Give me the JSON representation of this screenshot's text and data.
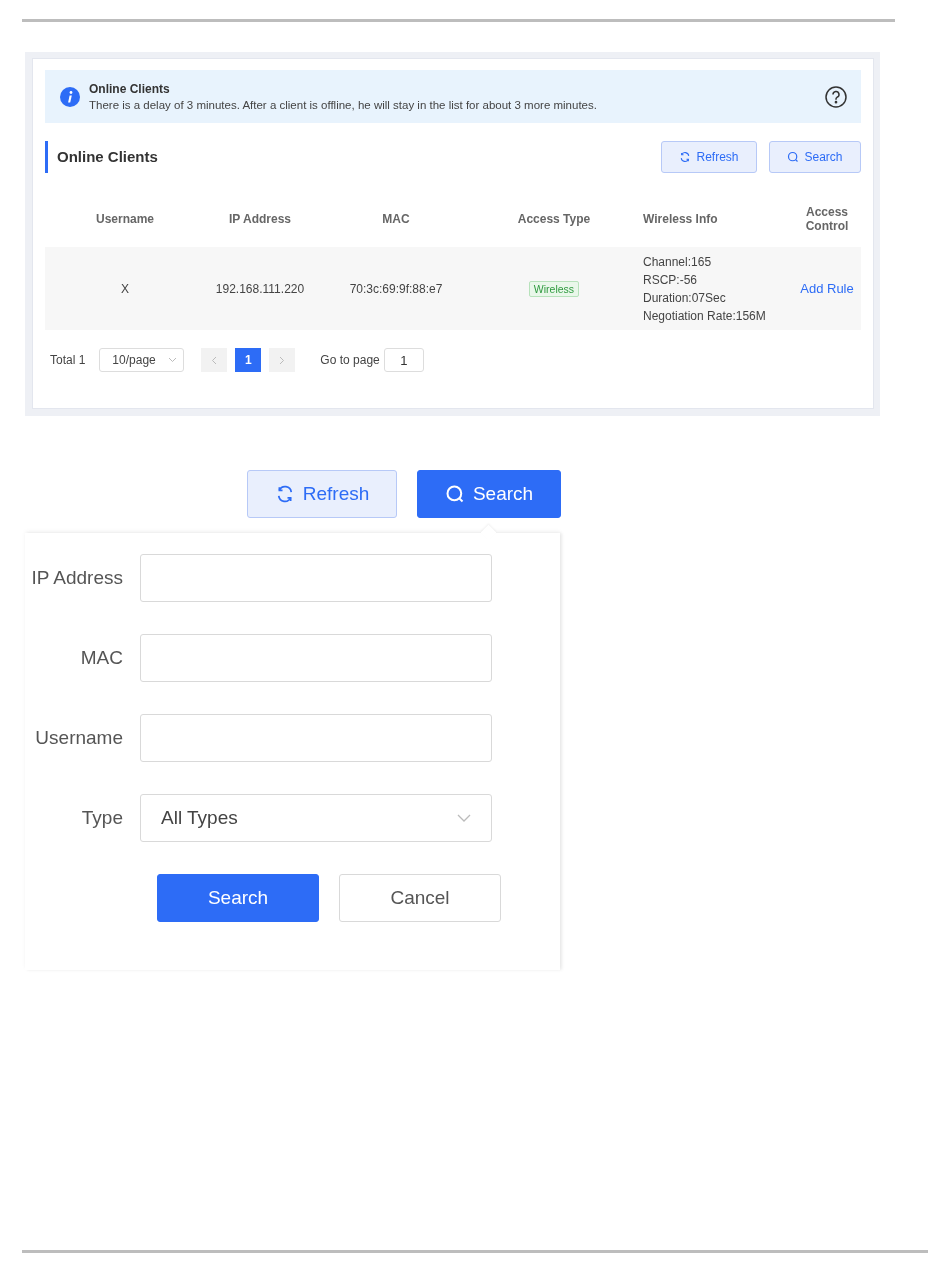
{
  "panel_1": {
    "alert": {
      "title": "Online Clients",
      "message": "There is a delay of 3 minutes. After a client is offline, he will stay in the list for about 3 more minutes."
    },
    "section_title": "Online Clients",
    "buttons": [
      {
        "label": "Refresh",
        "kind": "refresh",
        "selected": false
      },
      {
        "label": "Search",
        "kind": "search",
        "selected": false
      }
    ],
    "table": {
      "columns": [
        "Username",
        "IP Address",
        "MAC",
        "Access Type",
        "Wireless Info",
        "Access Control"
      ],
      "rows": [
        {
          "username": "X",
          "ip_address": "192.168.111.220",
          "mac": "70:3c:69:9f:88:e7",
          "access_type": "Wireless",
          "wireless_info": [
            "Channel:165",
            "RSCP:-56",
            "Duration:07Sec",
            "Negotiation Rate:156M"
          ],
          "access_control": "Add Rule"
        }
      ]
    },
    "pagination": {
      "total": "Total 1",
      "page_size": "10/page",
      "pages": [
        {
          "label": "1",
          "selected": true
        }
      ],
      "goto_label": "Go to page",
      "goto_value": "1"
    }
  },
  "panel_2": {
    "buttons": [
      {
        "label": "Refresh",
        "kind": "refresh",
        "selected": false
      },
      {
        "label": "Search",
        "kind": "search",
        "selected": true
      }
    ],
    "form": {
      "fields": [
        {
          "label": "IP Address",
          "kind": "text"
        },
        {
          "label": "MAC",
          "kind": "text"
        },
        {
          "label": "Username",
          "kind": "text"
        },
        {
          "label": "Type",
          "kind": "select",
          "value": "All Types"
        }
      ],
      "buttons": [
        {
          "label": "Search",
          "kind": "primary"
        },
        {
          "label": "Cancel",
          "kind": "default"
        }
      ]
    }
  }
}
